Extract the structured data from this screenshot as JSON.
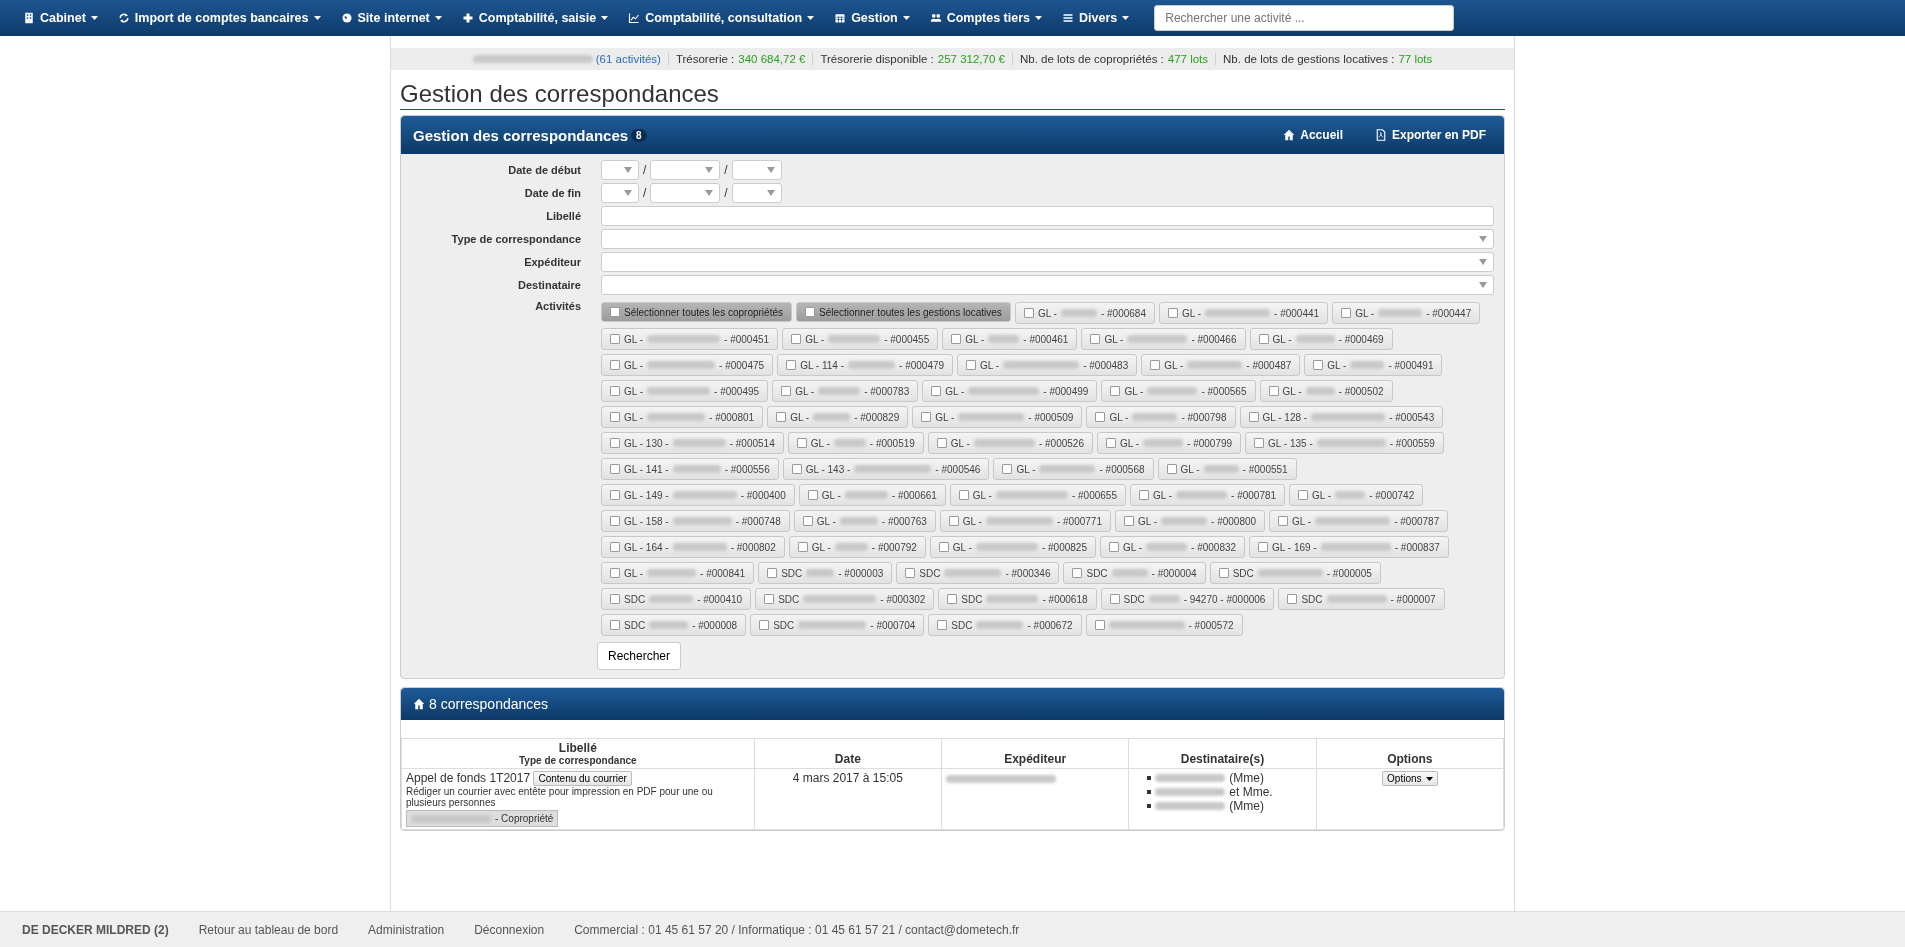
{
  "navbar": {
    "menus": [
      {
        "label": "Cabinet"
      },
      {
        "label": "Import de comptes bancaires"
      },
      {
        "label": "Site internet"
      },
      {
        "label": "Comptabilité, saisie"
      },
      {
        "label": "Comptabilité, consultation"
      },
      {
        "label": "Gestion"
      },
      {
        "label": "Comptes tiers"
      },
      {
        "label": "Divers"
      }
    ],
    "search": {
      "placeholder": "Rechercher une activité ..."
    }
  },
  "stats": {
    "activities_link": "(61 activités)",
    "items": [
      {
        "label": "Trésorerie :",
        "value": "340 684,72 €"
      },
      {
        "label": "Trésorerie disponible :",
        "value": "257 312,70 €"
      },
      {
        "label": "Nb. de lots de copropriétés :",
        "value": "477 lots"
      },
      {
        "label": "Nb. de lots de gestions locatives :",
        "value": "77 lots"
      }
    ]
  },
  "page_title": "Gestion des correspondances",
  "panel": {
    "title": "Gestion des correspondances",
    "badge": "8",
    "actions": [
      {
        "label": "Accueil"
      },
      {
        "label": "Exporter en PDF"
      }
    ]
  },
  "form": {
    "fields": [
      {
        "label": "Date de début",
        "kind": "date",
        "separators": [
          "/",
          "/"
        ]
      },
      {
        "label": "Date de fin",
        "kind": "date",
        "separators": [
          "/",
          "/"
        ]
      },
      {
        "label": "Libellé",
        "kind": "text"
      },
      {
        "label": "Type de correspondance",
        "kind": "select"
      },
      {
        "label": "Expéditeur",
        "kind": "select"
      },
      {
        "label": "Destinataire",
        "kind": "select"
      }
    ],
    "activities_label": "Activités",
    "activities": [
      {
        "kind": "select-all",
        "label": "Sélectionner toutes les copropriétés",
        "checked": false
      },
      {
        "kind": "select-all",
        "label": "Sélectionner toutes les gestions locatives",
        "checked": false
      },
      {
        "kind": "activity",
        "prefix": "GL -",
        "suffix": "- #000684",
        "checked": false
      },
      {
        "kind": "activity",
        "prefix": "GL -",
        "suffix": "- #000441",
        "checked": false
      },
      {
        "kind": "activity",
        "prefix": "GL -",
        "suffix": "- #000447",
        "checked": false
      },
      {
        "kind": "activity",
        "prefix": "GL -",
        "suffix": "- #000451",
        "checked": false
      },
      {
        "kind": "activity",
        "prefix": "GL -",
        "suffix": "- #000455",
        "checked": false
      },
      {
        "kind": "activity",
        "prefix": "GL -",
        "suffix": "- #000461",
        "checked": false
      },
      {
        "kind": "activity",
        "prefix": "GL -",
        "suffix": "- #000466",
        "checked": false
      },
      {
        "kind": "activity",
        "prefix": "GL -",
        "suffix": "- #000469",
        "checked": false
      },
      {
        "kind": "activity",
        "prefix": "GL -",
        "suffix": "- #000475",
        "checked": false
      },
      {
        "kind": "activity",
        "prefix": "GL - 114 -",
        "suffix": "- #000479",
        "checked": false
      },
      {
        "kind": "activity",
        "prefix": "GL -",
        "suffix": "- #000483",
        "checked": false
      },
      {
        "kind": "activity",
        "prefix": "GL -",
        "suffix": "- #000487",
        "checked": false
      },
      {
        "kind": "activity",
        "prefix": "GL -",
        "suffix": "- #000491",
        "checked": false
      },
      {
        "kind": "activity",
        "prefix": "GL -",
        "suffix": "- #000495",
        "checked": false
      },
      {
        "kind": "activity",
        "prefix": "GL -",
        "suffix": "- #000783",
        "checked": false
      },
      {
        "kind": "activity",
        "prefix": "GL -",
        "suffix": "- #000499",
        "checked": false
      },
      {
        "kind": "activity",
        "prefix": "GL -",
        "suffix": "- #000565",
        "checked": false
      },
      {
        "kind": "activity",
        "prefix": "GL -",
        "suffix": "- #000502",
        "checked": false
      },
      {
        "kind": "activity",
        "prefix": "GL -",
        "suffix": "- #000801",
        "checked": false
      },
      {
        "kind": "activity",
        "prefix": "GL -",
        "suffix": "- #000829",
        "checked": false
      },
      {
        "kind": "activity",
        "prefix": "GL -",
        "suffix": "- #000509",
        "checked": false
      },
      {
        "kind": "activity",
        "prefix": "GL -",
        "suffix": "- #000798",
        "checked": false
      },
      {
        "kind": "activity",
        "prefix": "GL - 128 -",
        "suffix": "- #000543",
        "checked": false
      },
      {
        "kind": "activity",
        "prefix": "GL - 130 -",
        "suffix": "- #000514",
        "checked": false
      },
      {
        "kind": "activity",
        "prefix": "GL -",
        "suffix": "- #000519",
        "checked": false
      },
      {
        "kind": "activity",
        "prefix": "GL -",
        "suffix": "- #000526",
        "checked": false
      },
      {
        "kind": "activity",
        "prefix": "GL -",
        "suffix": "- #000799",
        "checked": false
      },
      {
        "kind": "activity",
        "prefix": "GL - 135 -",
        "suffix": "- #000559",
        "checked": false
      },
      {
        "kind": "activity",
        "prefix": "GL - 141 -",
        "suffix": "- #000556",
        "checked": false
      },
      {
        "kind": "activity",
        "prefix": "GL - 143 -",
        "suffix": "- #000546",
        "checked": false
      },
      {
        "kind": "activity",
        "prefix": "GL -",
        "suffix": "- #000568",
        "checked": false
      },
      {
        "kind": "activity",
        "prefix": "GL -",
        "suffix": "- #000551",
        "checked": false
      },
      {
        "kind": "activity",
        "prefix": "GL - 149 -",
        "suffix": "- #000400",
        "checked": false
      },
      {
        "kind": "activity",
        "prefix": "GL -",
        "suffix": "- #000661",
        "checked": false
      },
      {
        "kind": "activity",
        "prefix": "GL -",
        "suffix": "- #000655",
        "checked": false
      },
      {
        "kind": "activity",
        "prefix": "GL -",
        "suffix": "- #000781",
        "checked": false
      },
      {
        "kind": "activity",
        "prefix": "GL -",
        "suffix": "- #000742",
        "checked": false
      },
      {
        "kind": "activity",
        "prefix": "GL - 158 -",
        "suffix": "- #000748",
        "checked": false
      },
      {
        "kind": "activity",
        "prefix": "GL -",
        "suffix": "- #000763",
        "checked": false
      },
      {
        "kind": "activity",
        "prefix": "GL -",
        "suffix": "- #000771",
        "checked": false
      },
      {
        "kind": "activity",
        "prefix": "GL -",
        "suffix": "- #000800",
        "checked": false
      },
      {
        "kind": "activity",
        "prefix": "GL -",
        "suffix": "- #000787",
        "checked": false
      },
      {
        "kind": "activity",
        "prefix": "GL - 164 -",
        "suffix": "- #000802",
        "checked": false
      },
      {
        "kind": "activity",
        "prefix": "GL -",
        "suffix": "- #000792",
        "checked": false
      },
      {
        "kind": "activity",
        "prefix": "GL -",
        "suffix": "- #000825",
        "checked": false
      },
      {
        "kind": "activity",
        "prefix": "GL -",
        "suffix": "- #000832",
        "checked": false
      },
      {
        "kind": "activity",
        "prefix": "GL - 169 -",
        "suffix": "- #000837",
        "checked": false
      },
      {
        "kind": "activity",
        "prefix": "GL -",
        "suffix": "- #000841",
        "checked": false
      },
      {
        "kind": "activity",
        "prefix": "SDC",
        "suffix": "- #000003",
        "checked": false
      },
      {
        "kind": "activity",
        "prefix": "SDC",
        "suffix": "- #000346",
        "checked": false
      },
      {
        "kind": "activity",
        "prefix": "SDC",
        "suffix": "- #000004",
        "checked": false
      },
      {
        "kind": "activity",
        "prefix": "SDC",
        "suffix": "- #000005",
        "checked": false
      },
      {
        "kind": "activity",
        "prefix": "SDC",
        "suffix": "- #000410",
        "checked": false
      },
      {
        "kind": "activity",
        "prefix": "SDC",
        "suffix": "- #000302",
        "checked": false
      },
      {
        "kind": "activity",
        "prefix": "SDC",
        "suffix": "- #000618",
        "checked": false
      },
      {
        "kind": "activity",
        "prefix": "SDC",
        "suffix": "- 94270 - #000006",
        "checked": false
      },
      {
        "kind": "activity",
        "prefix": "SDC",
        "suffix": "- #000007",
        "checked": false
      },
      {
        "kind": "activity",
        "prefix": "SDC",
        "suffix": "- #000008",
        "checked": false
      },
      {
        "kind": "activity",
        "prefix": "SDC",
        "suffix": "- #000704",
        "checked": false
      },
      {
        "kind": "activity",
        "prefix": "SDC",
        "suffix": "- #000672",
        "checked": false
      },
      {
        "kind": "activity",
        "suffix": "- #000572",
        "checked": false
      }
    ],
    "search_button": "Rechercher"
  },
  "results": {
    "title": "8 correspondances",
    "columns": [
      {
        "label": "Libellé",
        "sublabel": "Type de correspondance"
      },
      {
        "label": "Date"
      },
      {
        "label": "Expéditeur"
      },
      {
        "label": "Destinataire(s)"
      },
      {
        "label": "Options"
      }
    ],
    "rows": [
      {
        "libelle": "Appel de fonds 1T2017",
        "content_button": "Contenu du courrier",
        "description": "Rédiger un courrier avec entête pour impression en PDF pour une ou plusieurs personnes",
        "tag": "- Copropriété",
        "date": "4 mars 2017 à 15:05",
        "recipients": [
          {
            "text": "(Mme)"
          },
          {
            "text": "et Mme."
          },
          {
            "text": "(Mme)"
          }
        ],
        "options_button": "Options"
      }
    ]
  },
  "footer": {
    "user": "DE DECKER MILDRED (2)",
    "links": [
      "Retour au tableau de bord",
      "Administration",
      "Déconnexion"
    ],
    "contact": "Commercial : 01 45 61 57 20 / Informatique : 01 45 61 57 21 / contact@dometech.fr"
  }
}
